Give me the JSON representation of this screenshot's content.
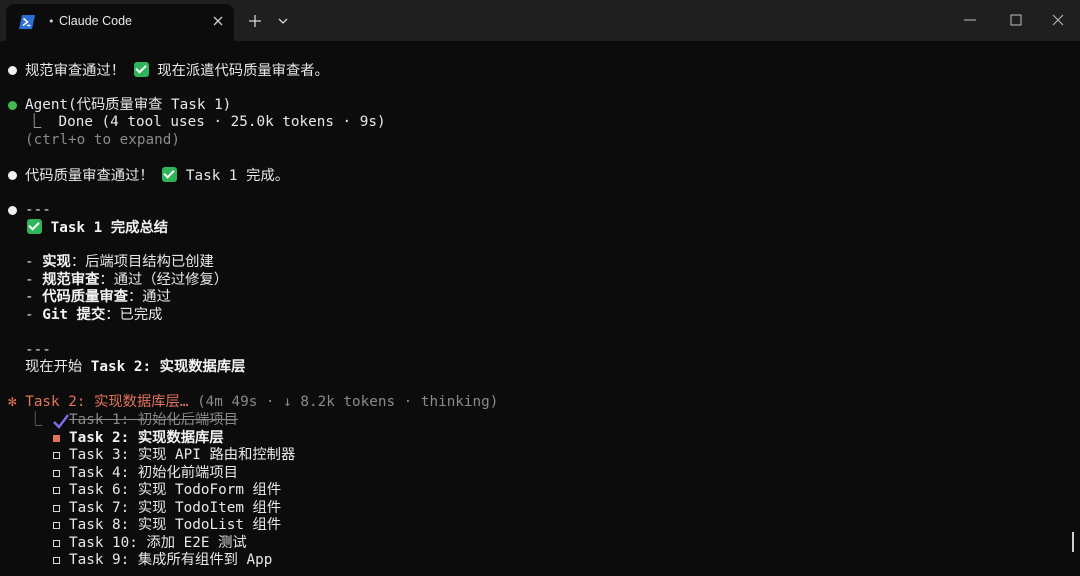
{
  "window": {
    "tab_title": "Claude Code",
    "tab_dot": "•",
    "new_tab": "+"
  },
  "colors": {
    "background": "#0c0c0c",
    "titlebar": "#1f1f1f",
    "accent_orange": "#e2735a",
    "agent_green": "#3fb950",
    "check_green": "#2fb45a",
    "strike_purple": "#7b6ee8"
  },
  "lines": {
    "l1": "规范审查通过！",
    "l1b": "现在派遣代码质量审查者。",
    "agent": "Agent(代码质量审查 Task 1)",
    "done": "⎿  Done (4 tool uses · 25.0k tokens · 9s)",
    "expand": "(ctrl+o to expand)",
    "l3": "代码质量审查通过！",
    "l3b": "Task 1 完成。",
    "rule1": "---",
    "summary": "Task 1 完成总结",
    "s1_key": "实现",
    "s1_val": "：后端项目结构已创建",
    "s2_key": "规范审查",
    "s2_val": "：通过（经过修复）",
    "s3_key": "代码质量审查",
    "s3_val": "：通过",
    "s4_key": "Git 提交",
    "s4_val": "：已完成",
    "dash": "- ",
    "rule2": "---",
    "next_a": "现在开始 ",
    "next_b": "Task 2: 实现数据库层",
    "active_star": "✻",
    "active_title": "Task 2: 实现数据库层…",
    "active_meta": " (4m 49s · ↓ 8.2k tokens · thinking)"
  },
  "tasks": [
    {
      "label": "Task 1: 初始化后端项目",
      "status": "done"
    },
    {
      "label": "Task 2: 实现数据库层",
      "status": "in_progress"
    },
    {
      "label": "Task 3: 实现 API 路由和控制器",
      "status": "pending"
    },
    {
      "label": "Task 4: 初始化前端项目",
      "status": "pending"
    },
    {
      "label": "Task 6: 实现 TodoForm 组件",
      "status": "pending"
    },
    {
      "label": "Task 7: 实现 TodoItem 组件",
      "status": "pending"
    },
    {
      "label": "Task 8: 实现 TodoList 组件",
      "status": "pending"
    },
    {
      "label": "Task 10: 添加 E2E 测试",
      "status": "pending"
    },
    {
      "label": "Task 9: 集成所有组件到 App",
      "status": "pending"
    }
  ],
  "tree_corner": "⎿"
}
